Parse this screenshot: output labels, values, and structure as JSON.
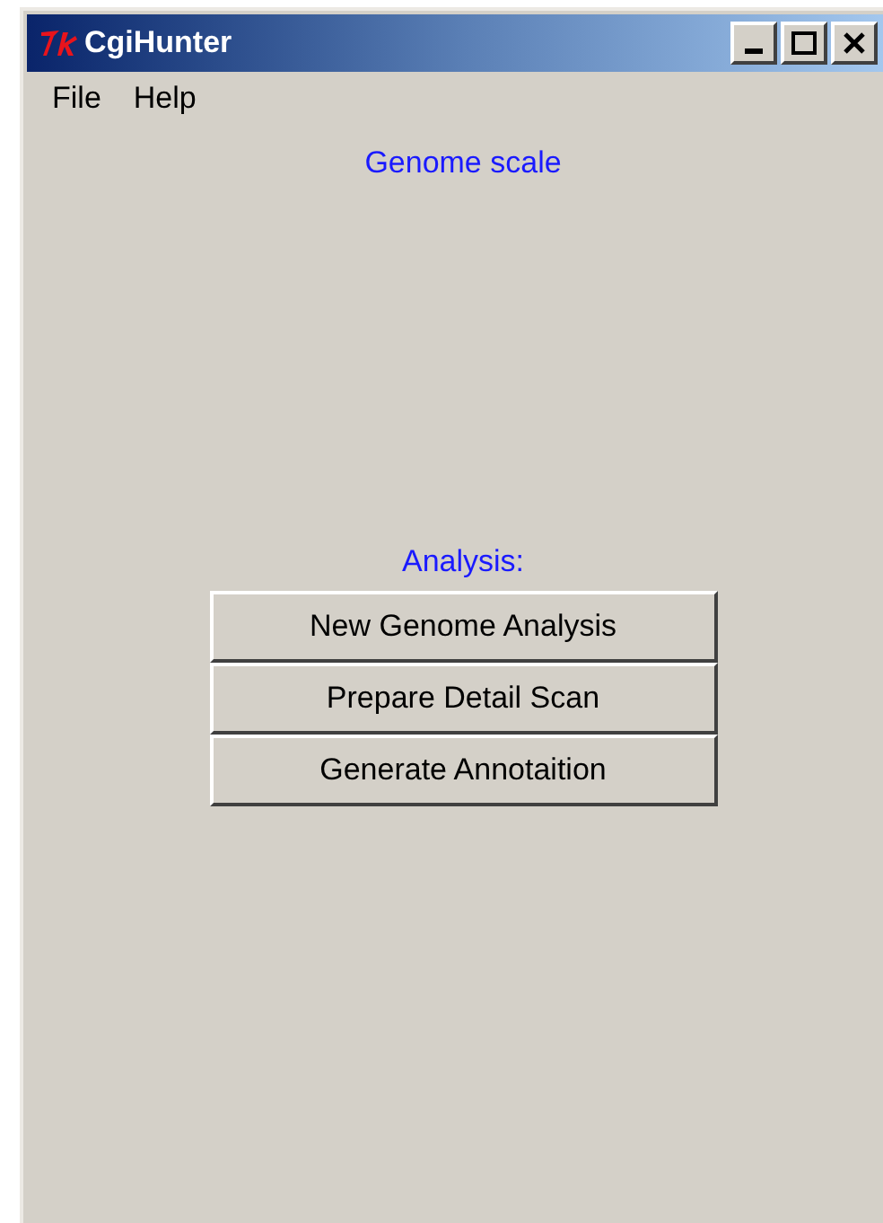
{
  "window": {
    "title": "CgiHunter"
  },
  "menu": [
    "File",
    "Help"
  ],
  "heading": "Genome scale",
  "analysis": {
    "label": "Analysis:",
    "buttons": [
      "New Genome Analysis",
      "Prepare Detail Scan",
      "Generate Annotaition"
    ]
  }
}
